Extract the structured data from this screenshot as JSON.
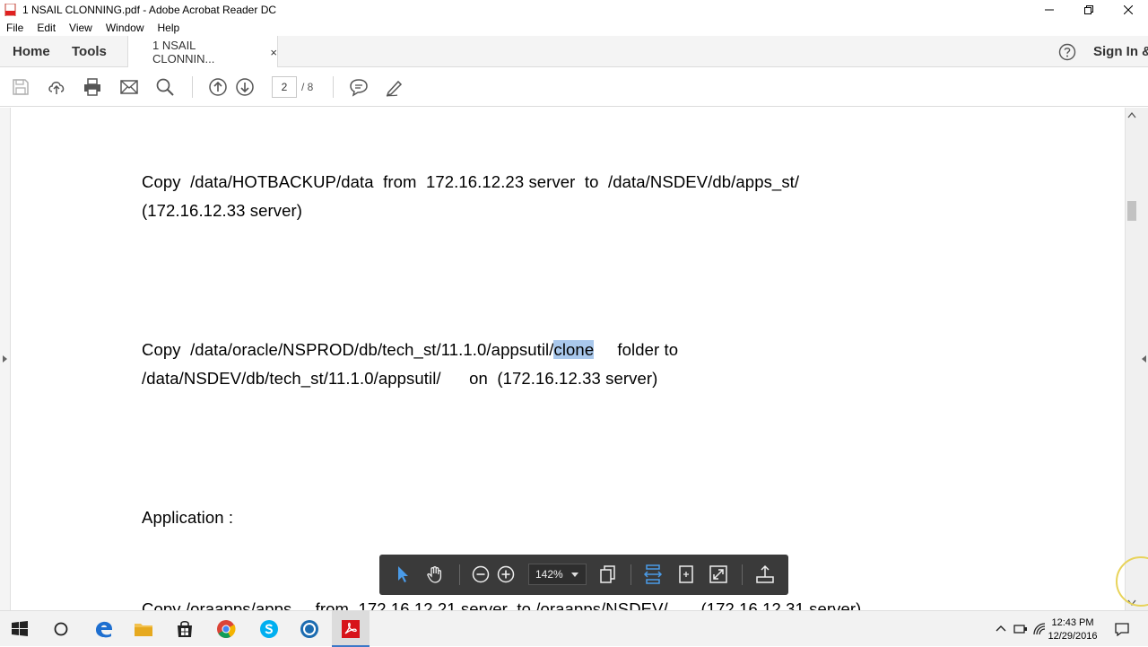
{
  "window": {
    "title": "1 NSAIL CLONNING.pdf - Adobe Acrobat Reader DC"
  },
  "menu": [
    "File",
    "Edit",
    "View",
    "Window",
    "Help"
  ],
  "tabs": {
    "home": "Home",
    "tools": "Tools",
    "document": "1 NSAIL CLONNIN...",
    "close": "×",
    "sign_in": "Sign In &"
  },
  "toolbar": {
    "current_page": "2",
    "page_total": "/ 8"
  },
  "document": {
    "para1_line1_a": "Copy  /data/HOTBACKUP/data  from  172.16.12.23 server  to  /data/NSDEV/db/apps_st/",
    "para1_line2": "(172.16.12.33 server)",
    "para2_line1_prefix": "Copy  /data/oracle/NSPROD/db/tech_st/11.1.0/appsutil/",
    "para2_line1_highlight": "clone",
    "para2_line1_suffix": "     folder to",
    "para2_line2": "/data/NSDEV/db/tech_st/11.1.0/appsutil/      on  (172.16.12.33 server)",
    "heading": "Application :",
    "para3_line1": "Copy /oraapps/apps     from  172.16.12.21 server  to /oraapps/NSDEV/       (172.16.12.31 server)"
  },
  "floating_toolbar": {
    "zoom": "142%"
  },
  "taskbar": {
    "time": "12:43 PM",
    "date": "12/29/2016"
  },
  "colors": {
    "highlight": "#a9c8ec",
    "float_bar": "#3a3a3a",
    "accent": "#3c78c8"
  }
}
